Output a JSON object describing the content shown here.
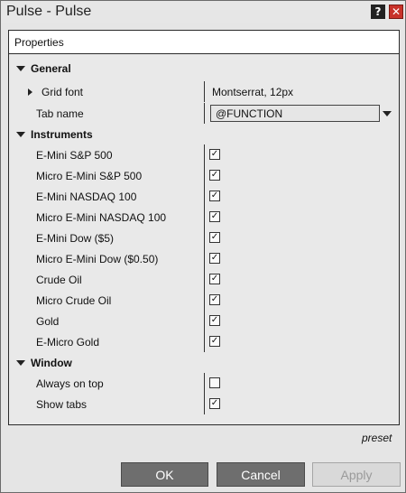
{
  "window": {
    "title": "Pulse - Pulse",
    "help_glyph": "?",
    "close_glyph": "✕"
  },
  "panel": {
    "header": "Properties",
    "general": {
      "label": "General",
      "grid_font": {
        "label": "Grid font",
        "value": "Montserrat, 12px"
      },
      "tab_name": {
        "label": "Tab name",
        "value": "@FUNCTION"
      }
    },
    "instruments": {
      "label": "Instruments",
      "items": [
        {
          "label": "E-Mini S&P 500",
          "checked": true
        },
        {
          "label": "Micro E-Mini S&P 500",
          "checked": true
        },
        {
          "label": "E-Mini NASDAQ 100",
          "checked": true
        },
        {
          "label": "Micro E-Mini NASDAQ 100",
          "checked": true
        },
        {
          "label": "E-Mini Dow ($5)",
          "checked": true
        },
        {
          "label": "Micro E-Mini Dow ($0.50)",
          "checked": true
        },
        {
          "label": "Crude Oil",
          "checked": true
        },
        {
          "label": "Micro Crude Oil",
          "checked": true
        },
        {
          "label": "Gold",
          "checked": true
        },
        {
          "label": "E-Micro Gold",
          "checked": true
        }
      ]
    },
    "window_section": {
      "label": "Window",
      "items": [
        {
          "label": "Always on top",
          "checked": false
        },
        {
          "label": "Show tabs",
          "checked": true
        }
      ]
    }
  },
  "footer": {
    "preset": "preset",
    "ok": "OK",
    "cancel": "Cancel",
    "apply": "Apply"
  },
  "check_glyph": "✓",
  "icons": {
    "expand": "caret-down-icon",
    "collapse": "caret-right-icon",
    "dropdown": "chevron-down-icon"
  }
}
